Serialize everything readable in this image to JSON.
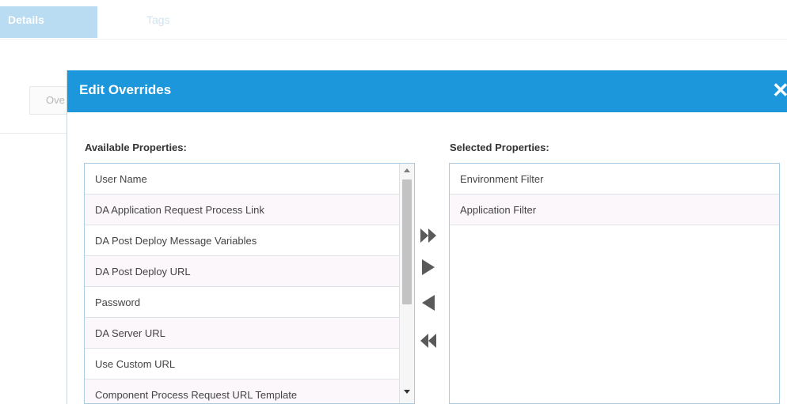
{
  "tabs": [
    {
      "label": "Details",
      "active": true
    },
    {
      "label": "Tags",
      "active": false
    }
  ],
  "background": {
    "partial_field_text": "Ove"
  },
  "modal": {
    "title": "Edit Overrides",
    "close_glyph": "✕",
    "available": {
      "label": "Available Properties:",
      "items": [
        "User Name",
        "DA Application Request Process Link",
        "DA Post Deploy Message Variables",
        "DA Post Deploy URL",
        "Password",
        "DA Server URL",
        "Use Custom URL",
        "Component Process Request URL Template"
      ]
    },
    "selected": {
      "label": "Selected Properties:",
      "items": [
        "Environment Filter",
        "Application Filter"
      ]
    },
    "buttons": {
      "add_all": "double-right-arrow-icon",
      "add": "right-arrow-icon",
      "remove": "left-arrow-icon",
      "remove_all": "double-left-arrow-icon"
    }
  },
  "colors": {
    "header": "#1c97dc",
    "active_tab": "#b9dcf2",
    "list_border": "#a9cbe2",
    "arrow": "#5a5a5a"
  }
}
